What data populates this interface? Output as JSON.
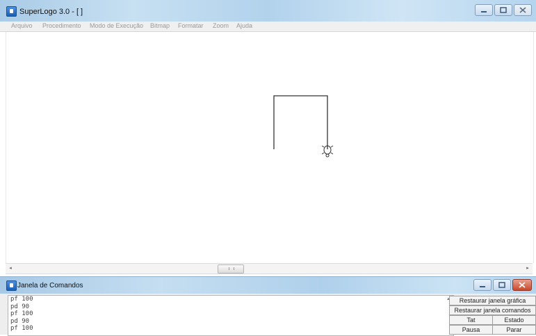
{
  "main_window": {
    "title": "SuperLogo 3.0 - [ ]",
    "menu": [
      "Arquivo",
      "Procedimento",
      "Modo de Execução",
      "Bitmap",
      "Formatar",
      "Zoom",
      "Ajuda"
    ]
  },
  "command_window": {
    "title": "Janela de Comandos",
    "lines": [
      "pf 100",
      "pd 90",
      "pf 100",
      "pd 90",
      "pf 100"
    ],
    "buttons": {
      "restore_graphics": "Restaurar janela gráfica",
      "restore_commands": "Restaurar janela comandos",
      "tat": "Tat",
      "estado": "Estado",
      "pausa": "Pausa",
      "parar": "Parar"
    }
  },
  "icons": {
    "app": "superlogo-app-icon",
    "turtle": "turtle-icon",
    "minimize": "minimize-icon",
    "maximize": "maximize-icon",
    "close": "close-icon"
  },
  "colors": {
    "titlebar": "#b7d5ee",
    "close_button": "#c8472c",
    "drawing_line": "#333333"
  }
}
